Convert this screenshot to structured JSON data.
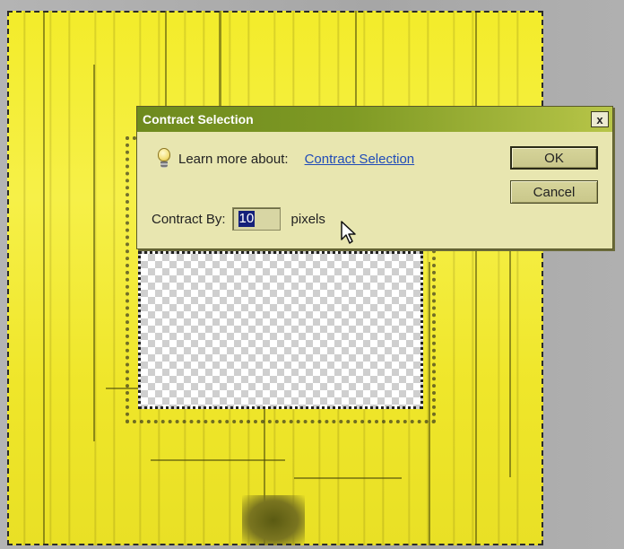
{
  "dialog": {
    "title": "Contract Selection",
    "close_label": "x",
    "learn_more_text": "Learn more about:",
    "learn_more_link": "Contract Selection",
    "contract_label": "Contract By:",
    "contract_value": "10",
    "unit_label": "pixels",
    "ok_label": "OK",
    "cancel_label": "Cancel"
  },
  "colors": {
    "canvas_yellow": "#f3ec2a",
    "titlebar_green": "#7f9a24",
    "dialog_bg": "#e8e6b0",
    "link_blue": "#1f4bb8"
  },
  "icons": {
    "tip": "lightbulb-icon",
    "cursor": "arrow-cursor-icon"
  }
}
